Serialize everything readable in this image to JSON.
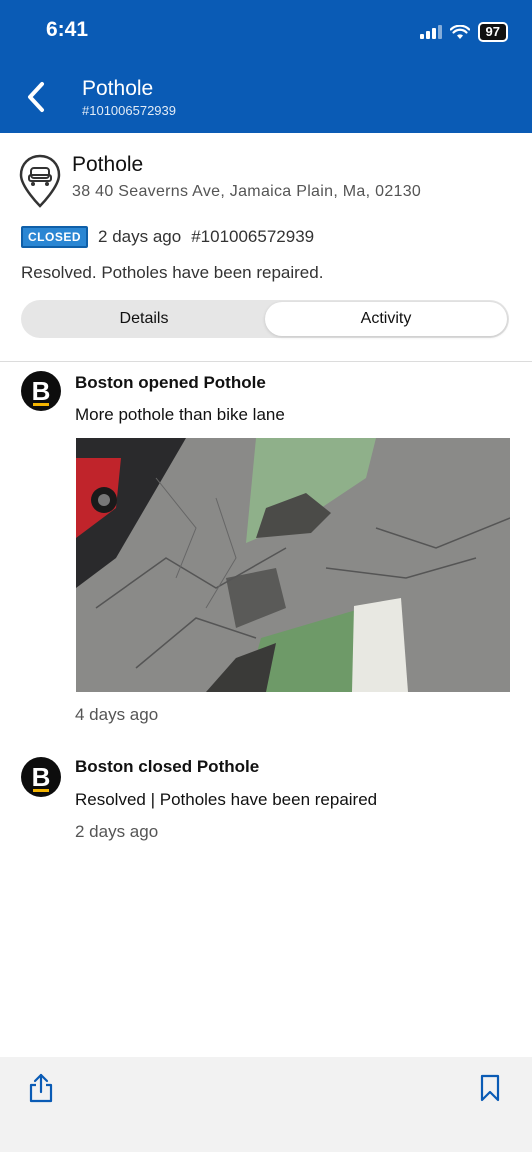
{
  "status_bar": {
    "time": "6:41",
    "battery": "97"
  },
  "header": {
    "title": "Pothole",
    "subtitle": "#101006572939"
  },
  "case": {
    "title": "Pothole",
    "address": "38 40 Seaverns Ave, Jamaica Plain, Ma, 02130",
    "badge": "CLOSED",
    "age": "2 days ago",
    "number": "#101006572939",
    "resolution": "Resolved. Potholes have been repaired."
  },
  "tabs": [
    {
      "label": "Details",
      "active": false
    },
    {
      "label": "Activity",
      "active": true
    }
  ],
  "activity": [
    {
      "avatar": "B",
      "title": "Boston opened Pothole",
      "text": "More pothole than bike lane",
      "time": "4 days ago"
    },
    {
      "avatar": "B",
      "title": "Boston closed Pothole",
      "text": "Resolved | Potholes have been repaired",
      "time": "2 days ago"
    }
  ],
  "icons": {
    "back": "chevron-left-icon",
    "pin": "location-pin-icon",
    "share": "share-icon",
    "bookmark": "bookmark-icon"
  },
  "colors": {
    "header": "#0a5bb5",
    "badge": "#2a86d3",
    "avatar": "#0d0d0d",
    "avatar_accent": "#f4b400"
  }
}
